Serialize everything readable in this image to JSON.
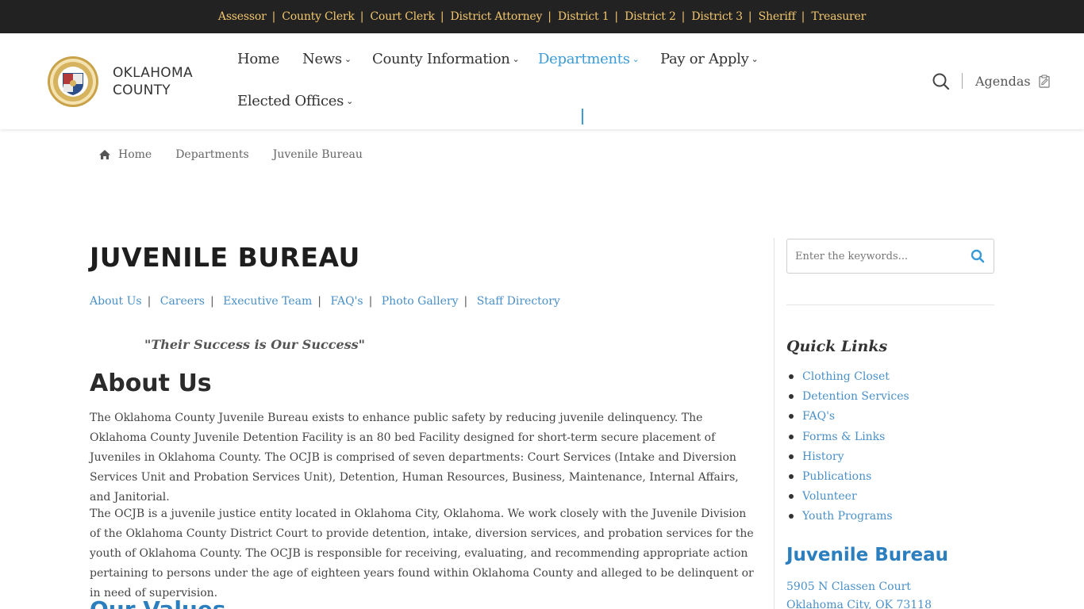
{
  "topbar": {
    "links": [
      "Assessor",
      "County Clerk",
      "Court Clerk",
      "District Attorney",
      "District 1",
      "District 2",
      "District 3",
      "Sheriff",
      "Treasurer"
    ]
  },
  "header": {
    "logo_line1": "OKLAHOMA",
    "logo_line2": "COUNTY",
    "nav": {
      "home": "Home",
      "news": "News",
      "county_information": "County Information",
      "departments": "Departments",
      "pay_or_apply": "Pay or Apply",
      "elected_offices": "Elected Offices"
    },
    "agendas": "Agendas",
    "accent_color": "#3a9bd6"
  },
  "breadcrumb": {
    "home": "Home",
    "departments": "Departments",
    "current": "Juvenile Bureau"
  },
  "main": {
    "title": "JUVENILE BUREAU",
    "sublinks": [
      "About Us",
      "Careers",
      "Executive Team",
      "FAQ's",
      "Photo Gallery",
      "Staff Directory"
    ],
    "motto": "\"Their Success is Our Success\"",
    "section_title": "About Us",
    "paragraph1": "The Oklahoma County Juvenile Bureau exists to enhance public safety by reducing juvenile delinquency. The Oklahoma County Juvenile Detention Facility is an 80 bed Facility designed for short-term secure placement of Juveniles in Oklahoma County. The OCJB is comprised of seven departments: Court Services (Intake and Diversion Services Unit and Probation Services Unit), Detention, Human Resources, Business, Maintenance, Internal Affairs, and Janitorial.",
    "paragraph2": "The OCJB is a juvenile justice entity located in Oklahoma City, Oklahoma.  We work closely with the Juvenile Division of the Oklahoma County District Court to provide detention, intake, diversion services, and probation services for the youth of Oklahoma County.  The OCJB is responsible for receiving, evaluating, and recommending appropriate action pertaining to persons under the age of eighteen years found within Oklahoma County and alleged to be delinquent or in need of supervision.",
    "section2_title": "Our Values"
  },
  "sidebar": {
    "search_placeholder": "Enter the keywords...",
    "quick_links_title": "Quick Links",
    "quick_links": [
      "Clothing Closet",
      "Detention Services",
      "FAQ's",
      "Forms & Links",
      "History",
      "Publications",
      "Volunteer",
      "Youth Programs"
    ],
    "bureau_title": "Juvenile Bureau",
    "address_line1": "5905 N Classen Court",
    "address_line2": "Oklahoma City, OK 73118"
  }
}
